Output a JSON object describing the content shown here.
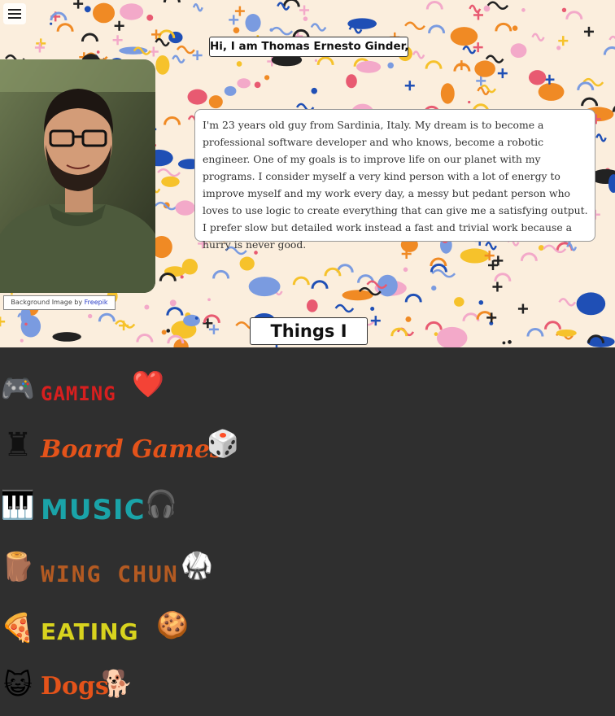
{
  "header": {
    "greeting": "Hi, I am Thomas Ernesto Ginder,"
  },
  "profile": {
    "bio": "I'm 23 years old guy from Sardinia, Italy. My dream is to become a professional software developer and who knows, become a robotic engineer. One of my goals is to improve life on our planet with my programs. I consider myself a very kind person with a lot of energy to improve myself and my work every day, a messy but pedant person who loves to use logic to create everything that can give me a satisfying output. I prefer slow but detailed work instead a fast and trivial work because a hurry is never good."
  },
  "credit": {
    "text": "Background Image by ",
    "link": "Freepik"
  },
  "likes": {
    "title": "Things I like:",
    "items": [
      {
        "label": "GAMING",
        "icon": "gamepad-icon",
        "lead_glyph": "🎮",
        "trail_icon": "heart-icon",
        "trail_glyph": "❤️"
      },
      {
        "label": "Board Games",
        "icon": "chess-piece-icon",
        "lead_glyph": "♜",
        "trail_icon": "dice-icon",
        "trail_glyph": "🎲"
      },
      {
        "label": "MUSIC",
        "icon": "keyboard-icon",
        "lead_glyph": "🎹",
        "trail_icon": "headphones-icon",
        "trail_glyph": "🎧"
      },
      {
        "label": "WING CHUN",
        "icon": "wooden-dummy-icon",
        "lead_glyph": "🪵",
        "trail_icon": "fighter-icon",
        "trail_glyph": "🥋"
      },
      {
        "label": "EATING",
        "icon": "pizza-icon",
        "lead_glyph": "🍕",
        "trail_icon": "cookie-icon",
        "trail_glyph": "🍪"
      },
      {
        "label": "Dogs",
        "icon": "cat-icon",
        "lead_glyph": "😺",
        "trail_icon": "dog-icon",
        "trail_glyph": "🐕"
      }
    ]
  }
}
